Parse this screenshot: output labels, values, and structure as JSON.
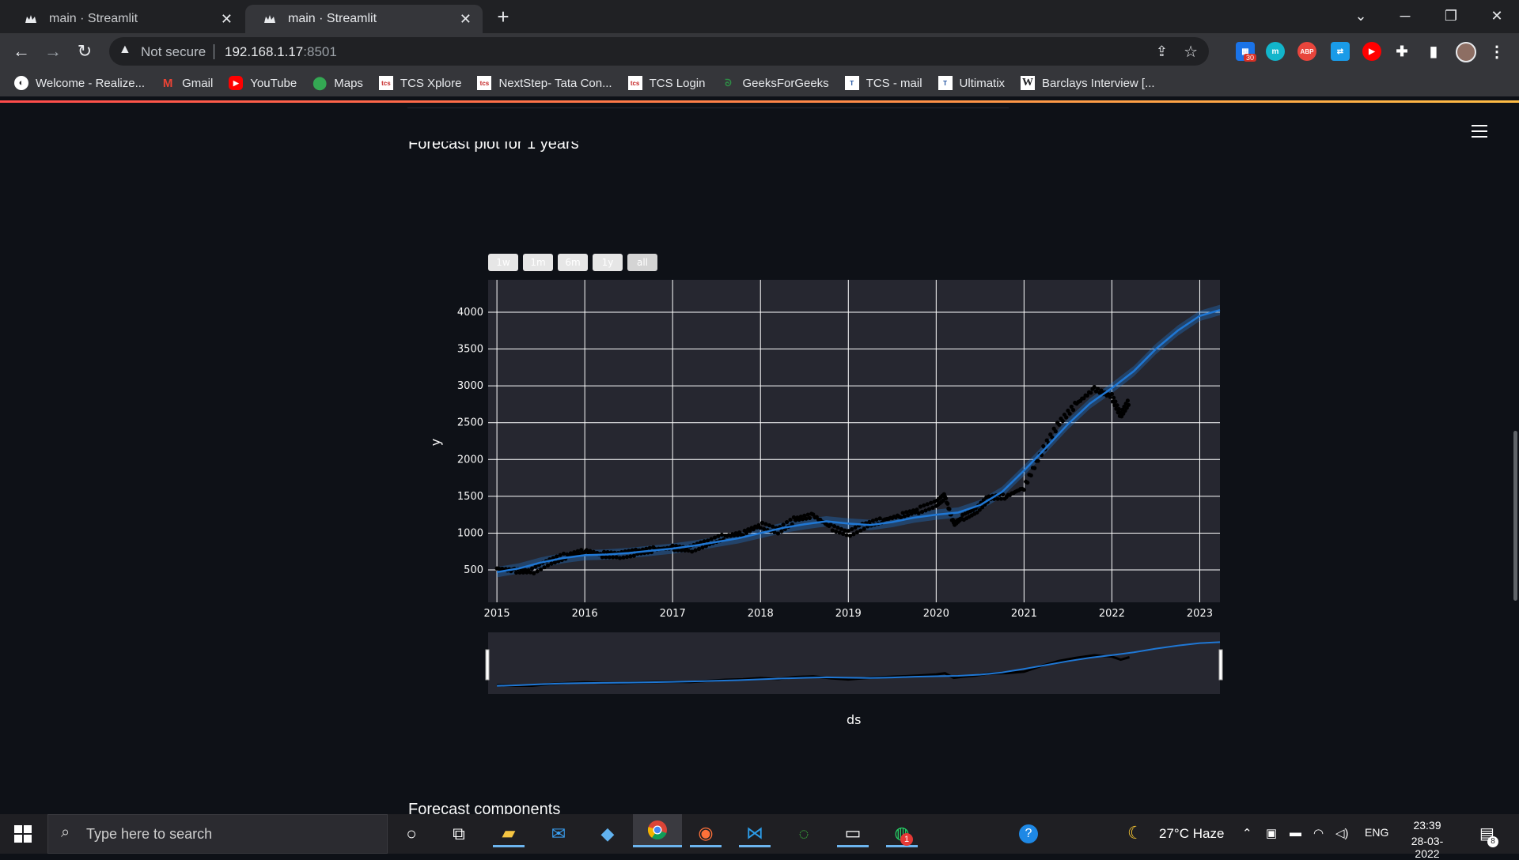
{
  "browser": {
    "tabs": [
      {
        "title": "main · Streamlit",
        "active": false
      },
      {
        "title": "main · Streamlit",
        "active": true
      }
    ],
    "new_tab_symbol": "+",
    "address": {
      "security_label": "Not secure",
      "host": "192.168.1.17",
      "port": ":8501"
    },
    "extensions": [
      {
        "name": "calendar-icon",
        "badge": "30",
        "color": "#1a73e8"
      },
      {
        "name": "m-icon",
        "text": "m",
        "color": "#12b5cb"
      },
      {
        "name": "adblock-icon",
        "text": "ABP",
        "color": "#e8453c"
      },
      {
        "name": "translate-icon",
        "text": "⇄",
        "color": "#1a9be8"
      },
      {
        "name": "youtube-ext-icon",
        "text": "▶",
        "color": "#ff0000"
      }
    ],
    "bookmarks": [
      {
        "label": "Welcome - Realize...",
        "icon": "realize-icon"
      },
      {
        "label": "Gmail",
        "icon": "gmail-icon"
      },
      {
        "label": "YouTube",
        "icon": "youtube-icon"
      },
      {
        "label": "Maps",
        "icon": "maps-icon"
      },
      {
        "label": "TCS Xplore",
        "icon": "tcs-icon"
      },
      {
        "label": "NextStep- Tata Con...",
        "icon": "tcs-icon"
      },
      {
        "label": "TCS Login",
        "icon": "tcs-icon"
      },
      {
        "label": "GeeksForGeeks",
        "icon": "gfg-icon"
      },
      {
        "label": "TCS - mail",
        "icon": "tata-icon"
      },
      {
        "label": "Ultimatix",
        "icon": "tata-icon"
      },
      {
        "label": "Barclays Interview [...",
        "icon": "w-icon"
      }
    ]
  },
  "page": {
    "plot_title": "Forecast plot for 1 years",
    "next_section_title": "Forecast components",
    "range_buttons": [
      "1w",
      "1m",
      "6m",
      "1y",
      "all"
    ],
    "xaxis_title": "ds",
    "yaxis_title": "y"
  },
  "chart_data": {
    "type": "line",
    "title": "",
    "xlabel": "ds",
    "ylabel": "y",
    "x_ticks": [
      "2015",
      "2016",
      "2017",
      "2018",
      "2019",
      "2020",
      "2021",
      "2022",
      "2023"
    ],
    "y_ticks": [
      500,
      1000,
      1500,
      2000,
      2500,
      3000,
      3500,
      4000
    ],
    "xlim": [
      2014.9,
      2023.23
    ],
    "ylim": [
      60,
      4440
    ],
    "grid": true,
    "series": [
      {
        "role": "forecast",
        "color": "#1f77d4",
        "x": [
          2015.0,
          2015.25,
          2015.5,
          2015.75,
          2016.0,
          2016.25,
          2016.5,
          2016.75,
          2017.0,
          2017.25,
          2017.5,
          2017.75,
          2018.0,
          2018.25,
          2018.5,
          2018.75,
          2019.0,
          2019.25,
          2019.5,
          2019.75,
          2020.0,
          2020.25,
          2020.5,
          2020.75,
          2021.0,
          2021.25,
          2021.5,
          2021.75,
          2022.0,
          2022.25,
          2022.5,
          2022.75,
          2023.0,
          2023.23
        ],
        "y": [
          470,
          520,
          600,
          660,
          700,
          710,
          730,
          760,
          790,
          830,
          880,
          930,
          1000,
          1070,
          1120,
          1160,
          1130,
          1110,
          1150,
          1210,
          1250,
          1280,
          1380,
          1560,
          1850,
          2160,
          2480,
          2760,
          2970,
          3200,
          3500,
          3750,
          3950,
          4030
        ]
      },
      {
        "role": "actual",
        "color": "#000000",
        "x": [
          2015.0,
          2015.2,
          2015.4,
          2015.6,
          2015.8,
          2016.0,
          2016.2,
          2016.4,
          2016.6,
          2016.8,
          2017.0,
          2017.2,
          2017.4,
          2017.6,
          2017.8,
          2018.0,
          2018.2,
          2018.4,
          2018.6,
          2018.8,
          2019.0,
          2019.2,
          2019.4,
          2019.6,
          2019.8,
          2020.0,
          2020.1,
          2020.2,
          2020.3,
          2020.45,
          2020.6,
          2020.8,
          2021.0,
          2021.2,
          2021.4,
          2021.6,
          2021.8,
          2022.0,
          2022.1,
          2022.2
        ],
        "y": [
          520,
          490,
          480,
          610,
          700,
          760,
          710,
          700,
          740,
          780,
          800,
          780,
          870,
          960,
          1000,
          1110,
          1030,
          1190,
          1240,
          1080,
          990,
          1110,
          1180,
          1240,
          1310,
          1400,
          1500,
          1120,
          1210,
          1300,
          1480,
          1500,
          1620,
          2100,
          2500,
          2760,
          2960,
          2850,
          2600,
          2800
        ]
      }
    ]
  },
  "taskbar": {
    "search_placeholder": "Type here to search",
    "weather": "27°C  Haze",
    "language": "ENG",
    "time": "23:39",
    "date": "28-03-2022",
    "notification_count": "8",
    "whatsapp_badge": "1"
  }
}
